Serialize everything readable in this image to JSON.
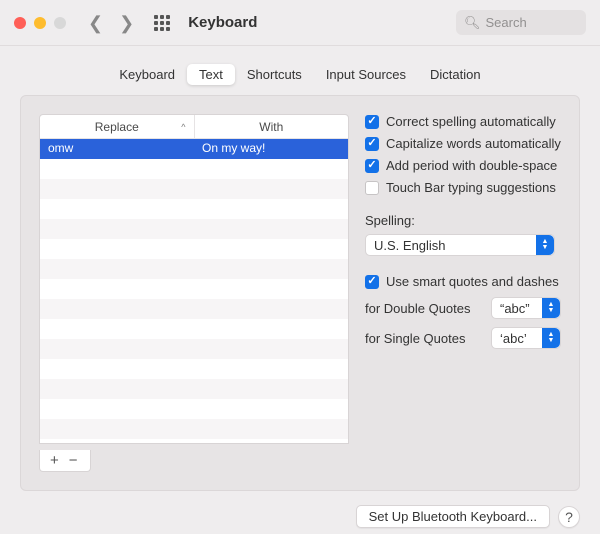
{
  "header": {
    "title": "Keyboard",
    "searchPlaceholder": "Search"
  },
  "tabs": [
    {
      "label": "Keyboard",
      "active": false
    },
    {
      "label": "Text",
      "active": true
    },
    {
      "label": "Shortcuts",
      "active": false
    },
    {
      "label": "Input Sources",
      "active": false
    },
    {
      "label": "Dictation",
      "active": false
    }
  ],
  "table": {
    "columns": [
      "Replace",
      "With"
    ],
    "rows": [
      {
        "replace": "omw",
        "with": "On my way!",
        "selected": true
      }
    ]
  },
  "options": {
    "correctSpelling": {
      "label": "Correct spelling automatically",
      "checked": true
    },
    "capitalize": {
      "label": "Capitalize words automatically",
      "checked": true
    },
    "addPeriod": {
      "label": "Add period with double-space",
      "checked": true
    },
    "touchBar": {
      "label": "Touch Bar typing suggestions",
      "checked": false
    },
    "spellingLabel": "Spelling:",
    "spellingValue": "U.S. English",
    "smartQuotes": {
      "label": "Use smart quotes and dashes",
      "checked": true
    },
    "doubleQuotesLabel": "for Double Quotes",
    "doubleQuotesValue": "“abc”",
    "singleQuotesLabel": "for Single Quotes",
    "singleQuotesValue": "‘abc’"
  },
  "footer": {
    "bluetooth": "Set Up Bluetooth Keyboard...",
    "help": "?"
  }
}
